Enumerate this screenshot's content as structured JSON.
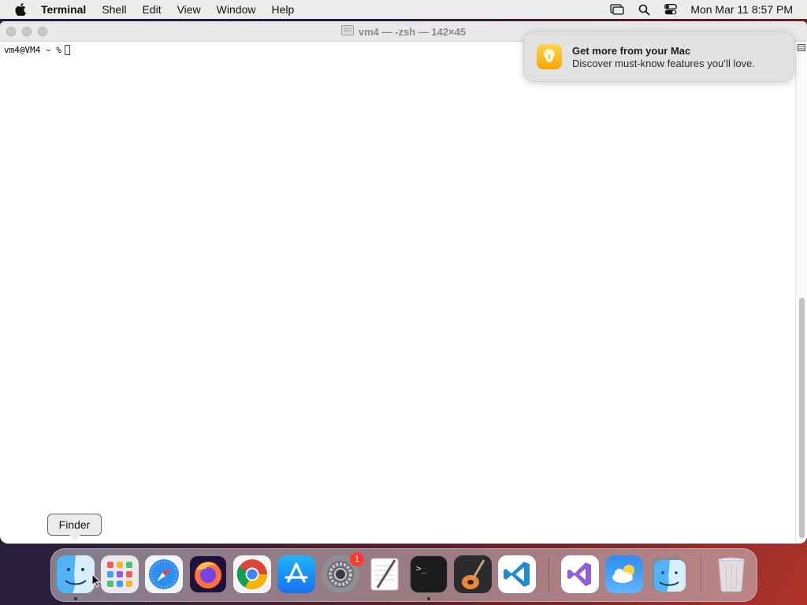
{
  "menubar": {
    "app_name": "Terminal",
    "items": [
      "Shell",
      "Edit",
      "View",
      "Window",
      "Help"
    ],
    "clock": "Mon Mar 11  8:57 PM"
  },
  "window": {
    "title": "vm4 — -zsh — 142×45",
    "prompt": "vm4@VM4 ~ %"
  },
  "notification": {
    "title": "Get more from your Mac",
    "subtitle": "Discover must-know features you’ll love."
  },
  "tooltip": {
    "label": "Finder"
  },
  "dock": {
    "apps": [
      "Finder",
      "Launchpad",
      "Safari",
      "Firefox",
      "Google Chrome",
      "App Store",
      "System Settings",
      "TextEdit",
      "Terminal",
      "GarageBand",
      "Visual Studio Code",
      "Visual Studio",
      "Weather",
      "Finder"
    ],
    "system_settings_badge": "1",
    "trash": "Trash"
  }
}
